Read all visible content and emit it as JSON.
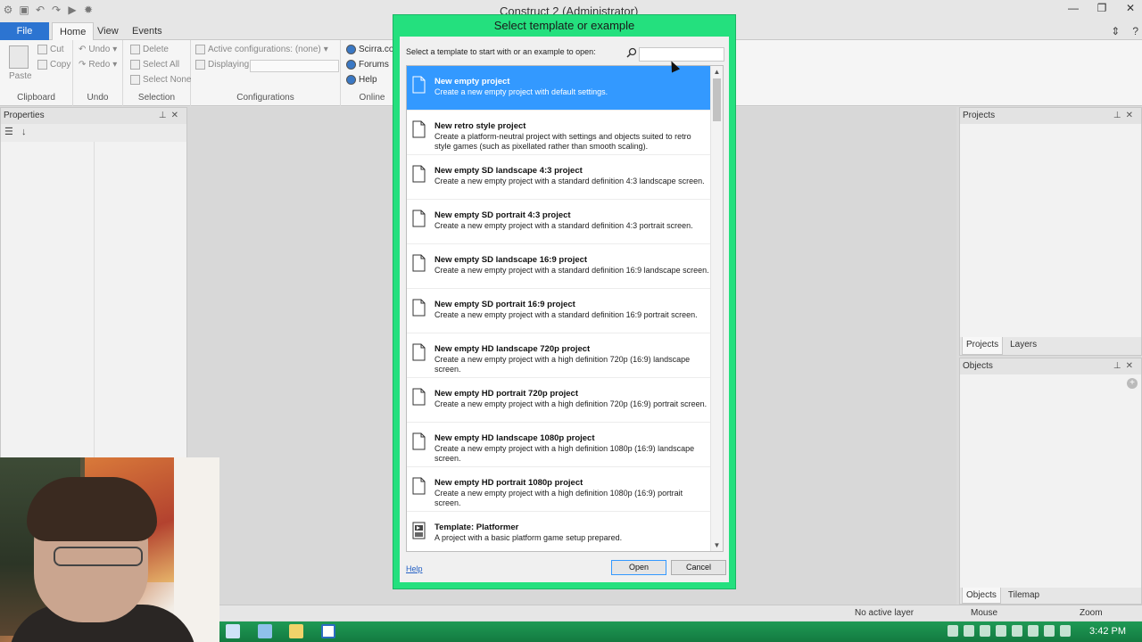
{
  "window": {
    "title": "Construct 2 (Administrator)"
  },
  "ribbon": {
    "tabs": [
      "File",
      "Home",
      "View",
      "Events"
    ],
    "clipboard": {
      "paste": "Paste",
      "cut": "Cut",
      "copy": "Copy",
      "label": "Clipboard"
    },
    "undo": {
      "undo": "Undo",
      "redo": "Redo",
      "label": "Undo"
    },
    "selection": {
      "delete": "Delete",
      "select_all": "Select All",
      "select_none": "Select None",
      "label": "Selection"
    },
    "configurations": {
      "active": "Active configurations: (none)",
      "displaying": "Displaying:",
      "label": "Configurations"
    },
    "online": {
      "scirra": "Scirra.com",
      "forums": "Forums",
      "help": "Help",
      "label": "Online"
    }
  },
  "panels": {
    "properties": {
      "title": "Properties"
    },
    "projects": {
      "title": "Projects",
      "tabs": [
        "Projects",
        "Layers"
      ]
    },
    "objects": {
      "title": "Objects",
      "tabs": [
        "Objects",
        "Tilemap"
      ]
    }
  },
  "statusbar": {
    "layer": "No active layer",
    "mouse": "Mouse",
    "zoom": "Zoom"
  },
  "taskbar": {
    "clock": "3:42 PM"
  },
  "dialog": {
    "title": "Select template or example",
    "prompt": "Select a template to start with or an example to open:",
    "search_value": "",
    "items": [
      {
        "title": "New empty project",
        "desc": "Create a new empty project with default settings.",
        "selected": true,
        "icon": "document-icon"
      },
      {
        "title": "New retro style project",
        "desc": "Create a platform-neutral project with settings and objects suited to retro style games (such as pixellated rather than smooth scaling).",
        "selected": false,
        "icon": "document-icon"
      },
      {
        "title": "New empty SD landscape 4:3 project",
        "desc": "Create a new empty project with a standard definition 4:3 landscape screen.",
        "selected": false,
        "icon": "document-icon"
      },
      {
        "title": "New empty SD portrait 4:3 project",
        "desc": "Create a new empty project with a standard definition 4:3 portrait screen.",
        "selected": false,
        "icon": "document-icon"
      },
      {
        "title": "New empty SD landscape 16:9 project",
        "desc": "Create a new empty project with a standard definition 16:9 landscape screen.",
        "selected": false,
        "icon": "document-icon"
      },
      {
        "title": "New empty SD portrait 16:9 project",
        "desc": "Create a new empty project with a standard definition 16:9 portrait screen.",
        "selected": false,
        "icon": "document-icon"
      },
      {
        "title": "New empty HD landscape 720p project",
        "desc": "Create a new empty project with a high definition 720p (16:9) landscape screen.",
        "selected": false,
        "icon": "document-icon"
      },
      {
        "title": "New empty HD portrait 720p project",
        "desc": "Create a new empty project with a high definition 720p (16:9) portrait screen.",
        "selected": false,
        "icon": "document-icon"
      },
      {
        "title": "New empty HD landscape 1080p project",
        "desc": "Create a new empty project with a high definition 1080p (16:9) landscape screen.",
        "selected": false,
        "icon": "document-icon"
      },
      {
        "title": "New empty HD portrait 1080p project",
        "desc": "Create a new empty project with a high definition 1080p (16:9) portrait screen.",
        "selected": false,
        "icon": "document-icon"
      },
      {
        "title": "Template: Platformer",
        "desc": "A project with a basic platform game setup prepared.",
        "selected": false,
        "icon": "game-template-icon"
      }
    ],
    "help": "Help",
    "open": "Open",
    "cancel": "Cancel"
  },
  "colors": {
    "accent": "#3399ff",
    "dialog_frame": "#24e07e",
    "file_tab": "#2c74d1",
    "taskbar": "#1a8a4a"
  }
}
